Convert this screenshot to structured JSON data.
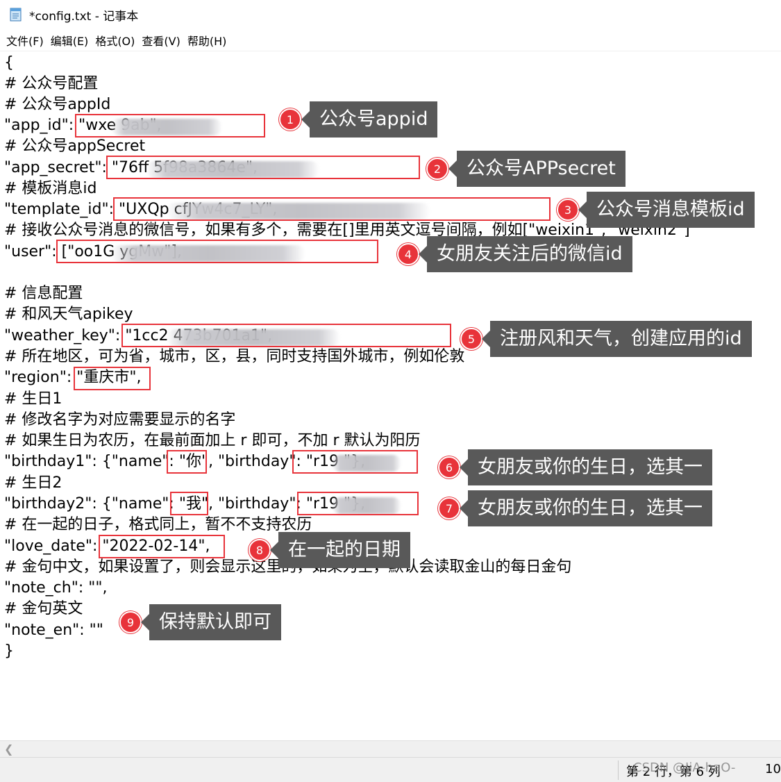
{
  "window": {
    "title": "*config.txt - 记事本",
    "icon": "notepad-icon"
  },
  "menu": [
    "文件(F)",
    "编辑(E)",
    "格式(O)",
    "查看(V)",
    "帮助(H)"
  ],
  "code_lines": [
    "{",
    "# 公众号配置",
    "# 公众号appId",
    "\"app_id\": \"wxe                              9ab\",",
    "# 公众号appSecret",
    "\"app_secret\": \"76ff                                               5f98a3864e\",",
    "# 模板消息id",
    "\"template_id\": \"UXQp                                                                         cfJYw4c7_LY\",",
    "# 接收公众号消息的微信号，如果有多个，需要在[]里用英文逗号间隔，例如[\"weixin1\", \"weixin2\"]",
    "\"user\": [\"oo1G                                              ygMw\"],",
    "",
    "# 信息配置",
    "# 和风天气apikey",
    "\"weather_key\": \"1cc2                                               473b701a1\",",
    "# 所在地区，可为省，城市，区，县，同时支持国外城市，例如伦敦",
    "\"region\": \"重庆市\",",
    "# 生日1",
    "# 修改名字为对应需要显示的名字",
    "# 如果生日为农历，在最前面加上 r 即可，不加 r 默认为阳历",
    "\"birthday1\": {\"name\": \"你\", \"birthday\": \"r19                 \"},",
    "# 生日2",
    "\"birthday2\": {\"name\": \"我\", \"birthday\": \"r19                 \"},",
    "# 在一起的日子，格式同上，暂不不支持农历",
    "\"love_date\": \"2022-02-14\",",
    "# 金句中文，如果设置了，则会显示这里的，如果为空，默认会读取金山的每日金句",
    "\"note_ch\": \"\",",
    "# 金句英文",
    "\"note_en\": \"\"",
    "}"
  ],
  "annotations": [
    {
      "number": "1",
      "label": "公众号appid"
    },
    {
      "number": "2",
      "label": "公众号APPsecret"
    },
    {
      "number": "3",
      "label": "公众号消息模板id"
    },
    {
      "number": "4",
      "label": "女朋友关注后的微信id"
    },
    {
      "number": "5",
      "label": "注册风和天气，创建应用的id"
    },
    {
      "number": "6",
      "label": "女朋友或你的生日，选其一"
    },
    {
      "number": "7",
      "label": "女朋友或你的生日，选其一"
    },
    {
      "number": "8",
      "label": "在一起的日期"
    },
    {
      "number": "9",
      "label": "保持默认即可"
    }
  ],
  "status": {
    "position": "第 2 行，第 6 列",
    "zoom": "10",
    "watermark": "CSDN @JiA-haO-"
  },
  "colors": {
    "highlight": "#e8333a",
    "callout_bg": "#595959"
  }
}
